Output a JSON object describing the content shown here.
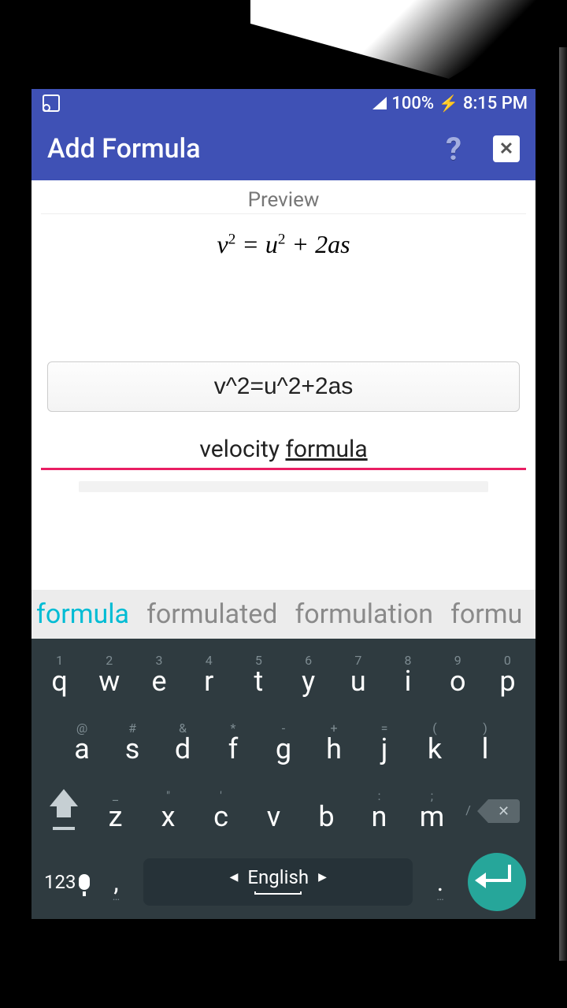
{
  "status": {
    "battery": "100%",
    "time": "8:15 PM"
  },
  "appbar": {
    "title": "Add Formula"
  },
  "preview": {
    "label": "Preview"
  },
  "inputs": {
    "formula": "v^2=u^2+2as",
    "title_word1": "velocity ",
    "title_word2": "formula"
  },
  "suggestions": [
    "formula",
    "formulated",
    "formulation",
    "formu"
  ],
  "keyboard": {
    "row1_hints": [
      "1",
      "2",
      "3",
      "4",
      "5",
      "6",
      "7",
      "8",
      "9",
      "0"
    ],
    "row1": [
      "q",
      "w",
      "e",
      "r",
      "t",
      "y",
      "u",
      "i",
      "o",
      "p"
    ],
    "row2_hints": [
      "@",
      "#",
      "&",
      "*",
      "-",
      "+",
      "=",
      "(",
      ")"
    ],
    "row2": [
      "a",
      "s",
      "d",
      "f",
      "g",
      "h",
      "j",
      "k",
      "l"
    ],
    "row3_hints": [
      "",
      "_",
      "\"",
      "'",
      "",
      "",
      ":",
      ";",
      "/"
    ],
    "row3": [
      "z",
      "x",
      "c",
      "v",
      "b",
      "n",
      "m"
    ],
    "sym": "123",
    "lang": "English",
    "comma": ",",
    "period": "."
  }
}
